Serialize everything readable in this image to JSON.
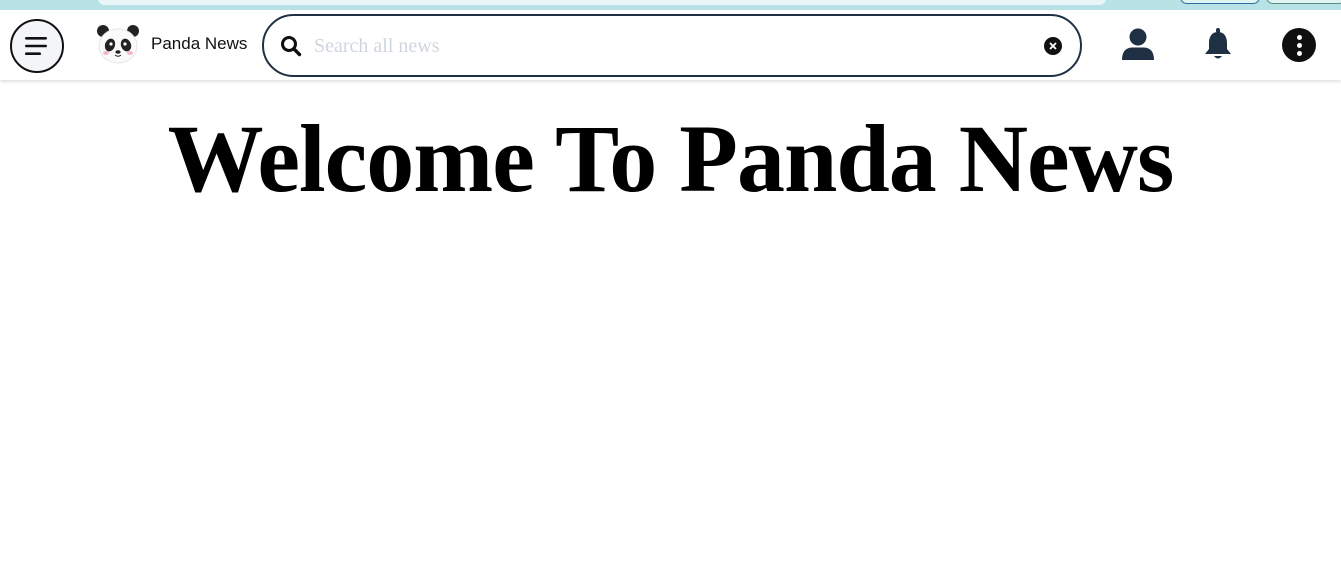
{
  "brand": {
    "name": "Panda News",
    "logo_icon": "panda-face-icon"
  },
  "search": {
    "placeholder": "Search all news",
    "value": "",
    "icon": "search-icon",
    "clear_icon": "clear-icon"
  },
  "nav_icons": [
    "menu-icon",
    "user-icon",
    "bell-icon",
    "more-vertical-icon"
  ],
  "hero": {
    "title": "Welcome To Panda News"
  },
  "colors": {
    "nav_icon": "#1f2f44",
    "search_border": "#1f2f44",
    "browser_strip": "#b8e2e6",
    "text": "#000000"
  }
}
